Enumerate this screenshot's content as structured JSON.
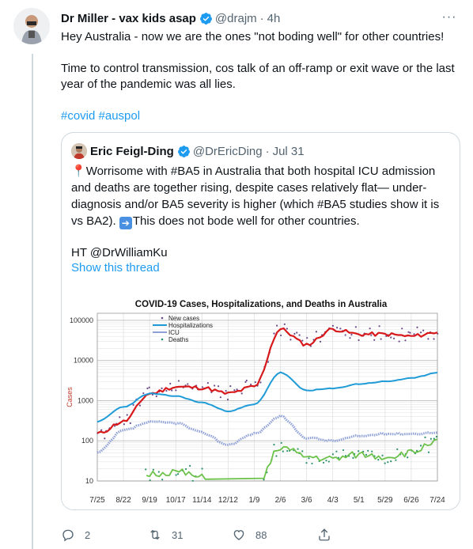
{
  "tweet": {
    "author_name": "Dr Miller - vax kids asap",
    "handle": "@drajm",
    "separator": "·",
    "time": "4h",
    "more_label": "···",
    "paragraph1": "Hey Australia - now we are the ones \"not boding well\" for other countries!",
    "paragraph2": "Time to control transmission, cos talk of an off-ramp or exit wave or the last year of the pandemic was all lies.",
    "hashtag1": "#covid",
    "hashtag2": "#auspol"
  },
  "quoted": {
    "author_name": "Eric Feigl-Ding",
    "handle": "@DrEricDing",
    "separator": "·",
    "date": "Jul 31",
    "text_line1": "Worrisome with #BA5 in Australia that both hospital ICU admission and deaths are together rising, despite cases relatively flat— under-diagnosis and/or BA5 severity is higher (which #BA5 studies show it is vs BA2).",
    "text_line1_tail": "This does not bode well for other countries.",
    "hat_tip": "HT @DrWilliamKu",
    "show_thread": "Show this thread"
  },
  "actions": {
    "reply_count": "2",
    "retweet_count": "31",
    "like_count": "88"
  },
  "chart_data": {
    "type": "line",
    "title": "COVID-19 Cases, Hospitalizations, and Deaths in Australia",
    "ylabel": "Cases",
    "xlabel": "",
    "yscale": "log",
    "ylim": [
      10,
      150000
    ],
    "y_ticks": [
      "100000",
      "10000",
      "1000",
      "100",
      "10"
    ],
    "y_tick_values": [
      100000,
      10000,
      1000,
      100,
      10
    ],
    "categories": [
      "7/25",
      "8/22",
      "9/19",
      "10/17",
      "11/14",
      "12/12",
      "1/9",
      "2/6",
      "3/6",
      "4/3",
      "5/1",
      "5/29",
      "6/26",
      "7/24"
    ],
    "legend": [
      "New cases",
      "Hospitalizations",
      "ICU",
      "Deaths"
    ],
    "legend_position": "top-left",
    "colors": {
      "cases_line": "#d7191c",
      "cases_dots": "#6b4a8a",
      "hosp": "#1f9bd7",
      "icu": "#8ea0d6",
      "deaths": "#6cc24a",
      "death_dots": "#2a8f6a"
    },
    "series": [
      {
        "name": "New cases",
        "values": [
          150,
          300,
          1500,
          2200,
          2100,
          1500,
          2200,
          60000,
          25000,
          60000,
          45000,
          45000,
          40000,
          50000
        ]
      },
      {
        "name": "Hospitalizations",
        "values": [
          300,
          700,
          1500,
          1300,
          900,
          550,
          800,
          5000,
          1800,
          2000,
          2600,
          3000,
          3600,
          5000
        ]
      },
      {
        "name": "ICU",
        "values": [
          50,
          180,
          290,
          280,
          160,
          80,
          150,
          400,
          120,
          100,
          130,
          150,
          150,
          160
        ]
      },
      {
        "name": "Deaths",
        "values": [
          0,
          0,
          15,
          17,
          12,
          0,
          5,
          70,
          40,
          35,
          45,
          40,
          50,
          110
        ]
      }
    ]
  }
}
